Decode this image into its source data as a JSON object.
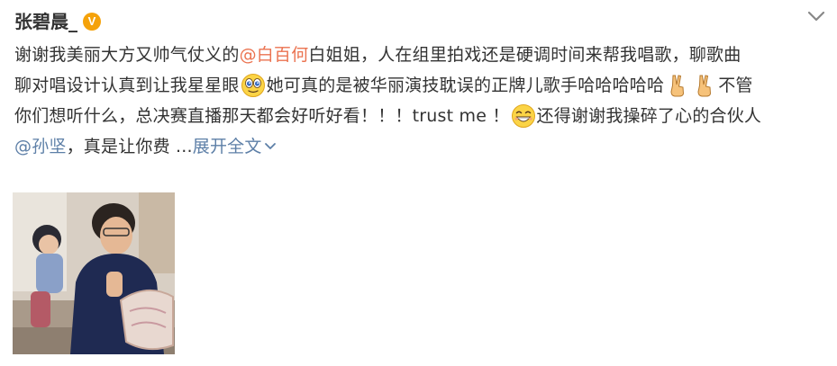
{
  "post": {
    "username": "张碧晨_",
    "verified_badge": "V",
    "line1_pre": "谢谢我美丽大方又帅气仗义的",
    "line1_mention": "@白百何",
    "line1_post": " 白姐姐，人在组里拍戏还是硬调时间来帮我唱歌，聊歌曲",
    "line2_pre": "聊对唱设计认真到让我星星眼",
    "line2_post": "她可真的是被华丽演技耽误的正牌儿歌手哈哈哈哈哈",
    "line2_tail": " 不管",
    "line3_pre": "你们想听什么，总决赛直播那天都会好听好看！！！trust me ！",
    "line3_post": "还得谢谢我操碎了心的合伙人",
    "line4_mention": "@孙坚",
    "line4_text": " ，真是让你费 ... ",
    "expand_label": "展开全文"
  },
  "icons": {
    "verified": "verified-v-badge-icon",
    "collapse": "chevron-down-icon",
    "emoji_starry": "starry-eyes-emoji-icon",
    "emoji_victory": "victory-hand-emoji-icon",
    "emoji_grin": "grin-emoji-icon"
  },
  "colors": {
    "mention_red": "#eb7350",
    "link_blue": "#5d7fa7",
    "badge_orange": "#f5a20a"
  }
}
